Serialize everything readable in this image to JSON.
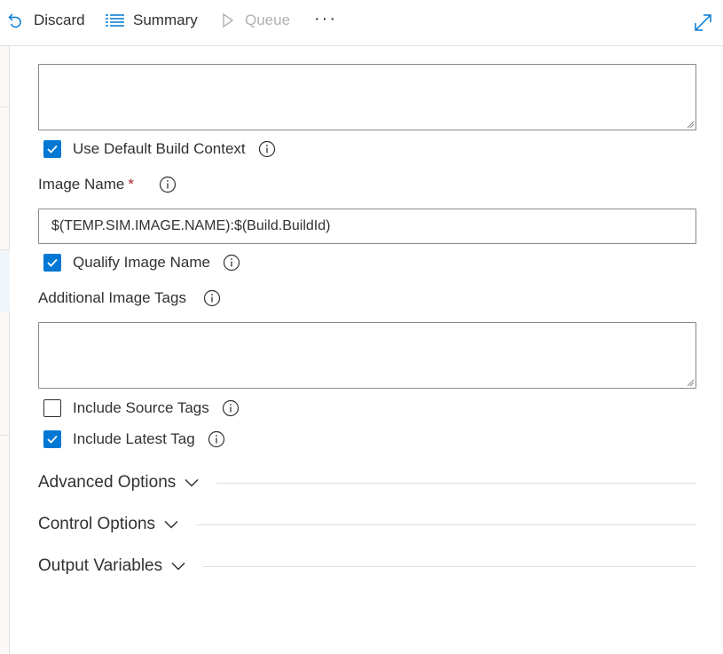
{
  "toolbar": {
    "discard_label": "Discard",
    "summary_label": "Summary",
    "queue_label": "Queue",
    "more_label": "···"
  },
  "form": {
    "build_context_checkbox": {
      "label": "Use Default Build Context",
      "checked": true
    },
    "image_name": {
      "label": "Image Name",
      "required_mark": "*",
      "value": "$(TEMP.SIM.IMAGE.NAME):$(Build.BuildId)"
    },
    "qualify_image_name_checkbox": {
      "label": "Qualify Image Name",
      "checked": true
    },
    "additional_image_tags": {
      "label": "Additional Image Tags",
      "value": ""
    },
    "include_source_tags_checkbox": {
      "label": "Include Source Tags",
      "checked": false
    },
    "include_latest_tag_checkbox": {
      "label": "Include Latest Tag",
      "checked": true
    }
  },
  "sections": {
    "advanced_options": "Advanced Options",
    "control_options": "Control Options",
    "output_variables": "Output Variables"
  },
  "colors": {
    "accent": "#0078d4",
    "text": "#323130",
    "border": "#8a8886",
    "required": "#a4262c"
  }
}
